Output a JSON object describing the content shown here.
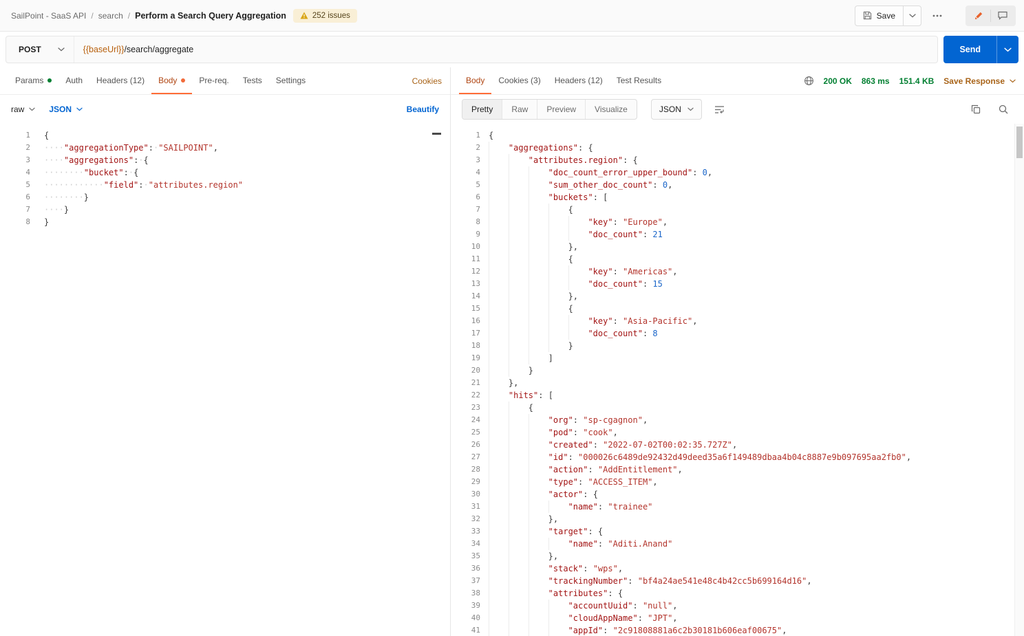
{
  "colors": {
    "accent_orange": "#ff6c37",
    "active_tab_text": "#b04613",
    "link_orange": "#a86318",
    "link_blue": "#0265d2",
    "success_green": "#007f31",
    "send_button_blue": "#0265d2",
    "variable_orange": "#b75f0b",
    "code_key_red": "#a31515",
    "code_string_red": "#b3342c",
    "code_number_blue": "#1b66c9",
    "warning_yellow": "#d9a514"
  },
  "header": {
    "breadcrumb": {
      "collection": "SailPoint - SaaS API",
      "separator": "/",
      "folder": "search",
      "request": "Perform a Search Query Aggregation"
    },
    "issues_badge": "252 issues",
    "save_button": "Save"
  },
  "request_bar": {
    "method": "POST",
    "url_variable": "{{baseUrl}}",
    "url_path": "/search/aggregate",
    "send_button": "Send"
  },
  "request_panel": {
    "tabs": [
      {
        "label": "Params"
      },
      {
        "label": "Auth"
      },
      {
        "label": "Headers (12)"
      },
      {
        "label": "Body"
      },
      {
        "label": "Pre-req."
      },
      {
        "label": "Tests"
      },
      {
        "label": "Settings"
      }
    ],
    "cookies_link": "Cookies",
    "body_type": "raw",
    "language": "JSON",
    "beautify_link": "Beautify",
    "code_lines": [
      {
        "indent": 0,
        "tokens": [
          [
            "p",
            "{"
          ]
        ]
      },
      {
        "indent": 0,
        "tokens": [
          [
            "ws",
            "····"
          ],
          [
            "k",
            "\"aggregationType\""
          ],
          [
            "p",
            ":"
          ],
          [
            "ws",
            "·"
          ],
          [
            "s",
            "\"SAILPOINT\""
          ],
          [
            "p",
            ","
          ]
        ]
      },
      {
        "indent": 0,
        "tokens": [
          [
            "ws",
            "····"
          ],
          [
            "k",
            "\"aggregations\""
          ],
          [
            "p",
            ":"
          ],
          [
            "ws",
            "·"
          ],
          [
            "p",
            "{"
          ]
        ]
      },
      {
        "indent": 0,
        "tokens": [
          [
            "ws",
            "········"
          ],
          [
            "k",
            "\"bucket\""
          ],
          [
            "p",
            ":"
          ],
          [
            "ws",
            "·"
          ],
          [
            "p",
            "{"
          ]
        ]
      },
      {
        "indent": 0,
        "tokens": [
          [
            "ws",
            "············"
          ],
          [
            "k",
            "\"field\""
          ],
          [
            "p",
            ":"
          ],
          [
            "ws",
            "·"
          ],
          [
            "s",
            "\"attributes.region\""
          ]
        ]
      },
      {
        "indent": 0,
        "tokens": [
          [
            "ws",
            "········"
          ],
          [
            "p",
            "}"
          ]
        ]
      },
      {
        "indent": 0,
        "tokens": [
          [
            "ws",
            "····"
          ],
          [
            "p",
            "}"
          ]
        ]
      },
      {
        "indent": 0,
        "tokens": [
          [
            "p",
            "}"
          ]
        ]
      }
    ]
  },
  "response_panel": {
    "tabs": [
      {
        "label": "Body"
      },
      {
        "label": "Cookies (3)"
      },
      {
        "label": "Headers (12)"
      },
      {
        "label": "Test Results"
      }
    ],
    "status": "200 OK",
    "time": "863 ms",
    "size": "151.4 KB",
    "save_response_link": "Save Response",
    "view_tabs": [
      {
        "label": "Pretty"
      },
      {
        "label": "Raw"
      },
      {
        "label": "Preview"
      },
      {
        "label": "Visualize"
      }
    ],
    "language": "JSON",
    "code_lines": [
      {
        "indent": 0,
        "tokens": [
          [
            "p",
            "{"
          ]
        ]
      },
      {
        "indent": 1,
        "tokens": [
          [
            "k",
            "\"aggregations\""
          ],
          [
            "p",
            ": {"
          ]
        ]
      },
      {
        "indent": 2,
        "tokens": [
          [
            "k",
            "\"attributes.region\""
          ],
          [
            "p",
            ": {"
          ]
        ]
      },
      {
        "indent": 3,
        "tokens": [
          [
            "k",
            "\"doc_count_error_upper_bound\""
          ],
          [
            "p",
            ": "
          ],
          [
            "n",
            "0"
          ],
          [
            "p",
            ","
          ]
        ]
      },
      {
        "indent": 3,
        "tokens": [
          [
            "k",
            "\"sum_other_doc_count\""
          ],
          [
            "p",
            ": "
          ],
          [
            "n",
            "0"
          ],
          [
            "p",
            ","
          ]
        ]
      },
      {
        "indent": 3,
        "tokens": [
          [
            "k",
            "\"buckets\""
          ],
          [
            "p",
            ": ["
          ]
        ]
      },
      {
        "indent": 4,
        "tokens": [
          [
            "p",
            "{"
          ]
        ]
      },
      {
        "indent": 5,
        "tokens": [
          [
            "k",
            "\"key\""
          ],
          [
            "p",
            ": "
          ],
          [
            "s",
            "\"Europe\""
          ],
          [
            "p",
            ","
          ]
        ]
      },
      {
        "indent": 5,
        "tokens": [
          [
            "k",
            "\"doc_count\""
          ],
          [
            "p",
            ": "
          ],
          [
            "n",
            "21"
          ]
        ]
      },
      {
        "indent": 4,
        "tokens": [
          [
            "p",
            "},"
          ]
        ]
      },
      {
        "indent": 4,
        "tokens": [
          [
            "p",
            "{"
          ]
        ]
      },
      {
        "indent": 5,
        "tokens": [
          [
            "k",
            "\"key\""
          ],
          [
            "p",
            ": "
          ],
          [
            "s",
            "\"Americas\""
          ],
          [
            "p",
            ","
          ]
        ]
      },
      {
        "indent": 5,
        "tokens": [
          [
            "k",
            "\"doc_count\""
          ],
          [
            "p",
            ": "
          ],
          [
            "n",
            "15"
          ]
        ]
      },
      {
        "indent": 4,
        "tokens": [
          [
            "p",
            "},"
          ]
        ]
      },
      {
        "indent": 4,
        "tokens": [
          [
            "p",
            "{"
          ]
        ]
      },
      {
        "indent": 5,
        "tokens": [
          [
            "k",
            "\"key\""
          ],
          [
            "p",
            ": "
          ],
          [
            "s",
            "\"Asia-Pacific\""
          ],
          [
            "p",
            ","
          ]
        ]
      },
      {
        "indent": 5,
        "tokens": [
          [
            "k",
            "\"doc_count\""
          ],
          [
            "p",
            ": "
          ],
          [
            "n",
            "8"
          ]
        ]
      },
      {
        "indent": 4,
        "tokens": [
          [
            "p",
            "}"
          ]
        ]
      },
      {
        "indent": 3,
        "tokens": [
          [
            "p",
            "]"
          ]
        ]
      },
      {
        "indent": 2,
        "tokens": [
          [
            "p",
            "}"
          ]
        ]
      },
      {
        "indent": 1,
        "tokens": [
          [
            "p",
            "},"
          ]
        ]
      },
      {
        "indent": 1,
        "tokens": [
          [
            "k",
            "\"hits\""
          ],
          [
            "p",
            ": ["
          ]
        ]
      },
      {
        "indent": 2,
        "tokens": [
          [
            "p",
            "{"
          ]
        ]
      },
      {
        "indent": 3,
        "tokens": [
          [
            "k",
            "\"org\""
          ],
          [
            "p",
            ": "
          ],
          [
            "s",
            "\"sp-cgagnon\""
          ],
          [
            "p",
            ","
          ]
        ]
      },
      {
        "indent": 3,
        "tokens": [
          [
            "k",
            "\"pod\""
          ],
          [
            "p",
            ": "
          ],
          [
            "s",
            "\"cook\""
          ],
          [
            "p",
            ","
          ]
        ]
      },
      {
        "indent": 3,
        "tokens": [
          [
            "k",
            "\"created\""
          ],
          [
            "p",
            ": "
          ],
          [
            "s",
            "\"2022-07-02T00:02:35.727Z\""
          ],
          [
            "p",
            ","
          ]
        ]
      },
      {
        "indent": 3,
        "tokens": [
          [
            "k",
            "\"id\""
          ],
          [
            "p",
            ": "
          ],
          [
            "s",
            "\"000026c6489de92432d49deed35a6f149489dbaa4b04c8887e9b097695aa2fb0\""
          ],
          [
            "p",
            ","
          ]
        ]
      },
      {
        "indent": 3,
        "tokens": [
          [
            "k",
            "\"action\""
          ],
          [
            "p",
            ": "
          ],
          [
            "s",
            "\"AddEntitlement\""
          ],
          [
            "p",
            ","
          ]
        ]
      },
      {
        "indent": 3,
        "tokens": [
          [
            "k",
            "\"type\""
          ],
          [
            "p",
            ": "
          ],
          [
            "s",
            "\"ACCESS_ITEM\""
          ],
          [
            "p",
            ","
          ]
        ]
      },
      {
        "indent": 3,
        "tokens": [
          [
            "k",
            "\"actor\""
          ],
          [
            "p",
            ": {"
          ]
        ]
      },
      {
        "indent": 4,
        "tokens": [
          [
            "k",
            "\"name\""
          ],
          [
            "p",
            ": "
          ],
          [
            "s",
            "\"trainee\""
          ]
        ]
      },
      {
        "indent": 3,
        "tokens": [
          [
            "p",
            "},"
          ]
        ]
      },
      {
        "indent": 3,
        "tokens": [
          [
            "k",
            "\"target\""
          ],
          [
            "p",
            ": {"
          ]
        ]
      },
      {
        "indent": 4,
        "tokens": [
          [
            "k",
            "\"name\""
          ],
          [
            "p",
            ": "
          ],
          [
            "s",
            "\"Aditi.Anand\""
          ]
        ]
      },
      {
        "indent": 3,
        "tokens": [
          [
            "p",
            "},"
          ]
        ]
      },
      {
        "indent": 3,
        "tokens": [
          [
            "k",
            "\"stack\""
          ],
          [
            "p",
            ": "
          ],
          [
            "s",
            "\"wps\""
          ],
          [
            "p",
            ","
          ]
        ]
      },
      {
        "indent": 3,
        "tokens": [
          [
            "k",
            "\"trackingNumber\""
          ],
          [
            "p",
            ": "
          ],
          [
            "s",
            "\"bf4a24ae541e48c4b42cc5b699164d16\""
          ],
          [
            "p",
            ","
          ]
        ]
      },
      {
        "indent": 3,
        "tokens": [
          [
            "k",
            "\"attributes\""
          ],
          [
            "p",
            ": {"
          ]
        ]
      },
      {
        "indent": 4,
        "tokens": [
          [
            "k",
            "\"accountUuid\""
          ],
          [
            "p",
            ": "
          ],
          [
            "s",
            "\"null\""
          ],
          [
            "p",
            ","
          ]
        ]
      },
      {
        "indent": 4,
        "tokens": [
          [
            "k",
            "\"cloudAppName\""
          ],
          [
            "p",
            ": "
          ],
          [
            "s",
            "\"JPT\""
          ],
          [
            "p",
            ","
          ]
        ]
      },
      {
        "indent": 4,
        "tokens": [
          [
            "k",
            "\"appId\""
          ],
          [
            "p",
            ": "
          ],
          [
            "s",
            "\"2c91808881a6c2b30181b606eaf00675\""
          ],
          [
            "p",
            ","
          ]
        ]
      }
    ]
  }
}
